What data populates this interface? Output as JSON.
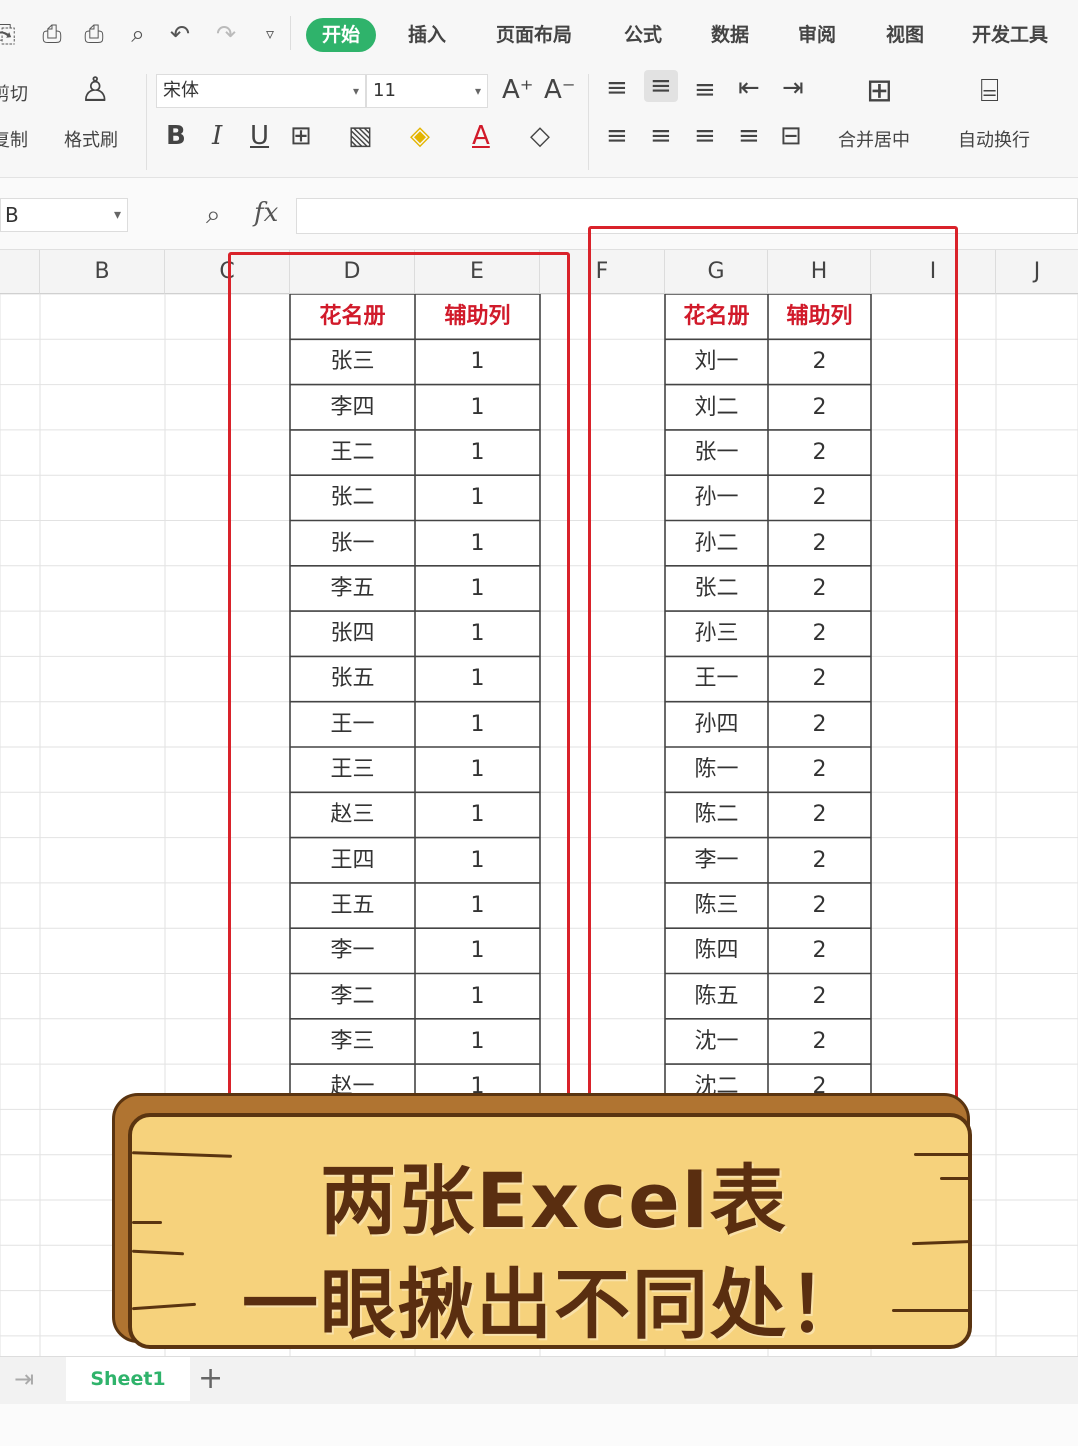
{
  "menu_tabs": [
    "开始",
    "插入",
    "页面布局",
    "公式",
    "数据",
    "审阅",
    "视图",
    "开发工具"
  ],
  "ribbon": {
    "cut": "剪切",
    "copy": "复制",
    "format_painter": "格式刷",
    "font_name": "宋体",
    "font_size": "11",
    "merge_center": "合并居中",
    "wrap_text": "自动换行",
    "bold": "B",
    "italic": "I",
    "underline": "U"
  },
  "formula_bar": {
    "name_box": "B",
    "fx": "fx"
  },
  "columns": [
    "B",
    "C",
    "D",
    "E",
    "F",
    "G",
    "H",
    "I",
    "J"
  ],
  "table1": {
    "headers": [
      "花名册",
      "辅助列"
    ],
    "rows": [
      [
        "张三",
        "1"
      ],
      [
        "李四",
        "1"
      ],
      [
        "王二",
        "1"
      ],
      [
        "张二",
        "1"
      ],
      [
        "张一",
        "1"
      ],
      [
        "李五",
        "1"
      ],
      [
        "张四",
        "1"
      ],
      [
        "张五",
        "1"
      ],
      [
        "王一",
        "1"
      ],
      [
        "王三",
        "1"
      ],
      [
        "赵三",
        "1"
      ],
      [
        "王四",
        "1"
      ],
      [
        "王五",
        "1"
      ],
      [
        "李一",
        "1"
      ],
      [
        "李二",
        "1"
      ],
      [
        "李三",
        "1"
      ],
      [
        "赵一",
        "1"
      ]
    ]
  },
  "table2": {
    "headers": [
      "花名册",
      "辅助列"
    ],
    "rows": [
      [
        "刘一",
        "2"
      ],
      [
        "刘二",
        "2"
      ],
      [
        "张一",
        "2"
      ],
      [
        "孙一",
        "2"
      ],
      [
        "孙二",
        "2"
      ],
      [
        "张二",
        "2"
      ],
      [
        "孙三",
        "2"
      ],
      [
        "王一",
        "2"
      ],
      [
        "孙四",
        "2"
      ],
      [
        "陈一",
        "2"
      ],
      [
        "陈二",
        "2"
      ],
      [
        "李一",
        "2"
      ],
      [
        "陈三",
        "2"
      ],
      [
        "陈四",
        "2"
      ],
      [
        "陈五",
        "2"
      ],
      [
        "沈一",
        "2"
      ],
      [
        "沈二",
        "2"
      ]
    ]
  },
  "sheet_tab": "Sheet1",
  "banner": {
    "line1": "两张Excel表",
    "line2": "一眼揪出不同处！"
  },
  "colors": {
    "accent_green": "#2fb36b",
    "highlight_red": "#d9222a",
    "header_red": "#d11a2a",
    "banner_fill": "#f6d27c",
    "banner_border": "#5a3410"
  }
}
